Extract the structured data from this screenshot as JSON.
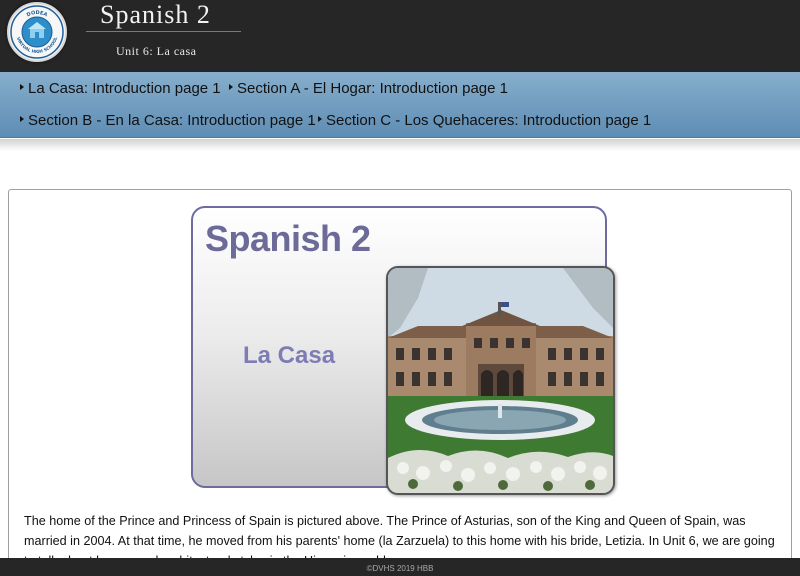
{
  "header": {
    "logo_icon": "school-seal-icon",
    "logo_text_top": "DODEA",
    "logo_text_bottom": "VIRTUAL HIGH SCHOOL",
    "title": "Spanish 2",
    "subtitle": "Unit 6: La casa"
  },
  "nav": {
    "items": [
      {
        "label": "La Casa: Introduction page 1",
        "current": true
      },
      {
        "label": "Section A - El Hogar: Introduction page 1"
      },
      {
        "label": "Section B - En la Casa: Introduction page 1"
      },
      {
        "label": "Section C - Los Quehaceres: Introduction page 1"
      }
    ]
  },
  "banner": {
    "title": "Spanish 2",
    "subtitle": "La Casa",
    "photo_icon": "palace-photo-image"
  },
  "content": {
    "paragraph": "The home of the Prince and Princess of Spain is pictured above. The Prince of Asturias, son of the King and Queen of Spain, was married in 2004. At that time, he moved from his parents' home (la Zarzuela) to this home with his bride, Letizia. In Unit 6, we are going to talk about homes and architectural styles in the Hispanic world."
  },
  "footer": {
    "text": "©DVHS 2019 HBB"
  },
  "colors": {
    "header_bg": "#262626",
    "nav_top": "#87aecc",
    "nav_bottom": "#5e8db4",
    "banner_title": "#6b6a98",
    "banner_subtitle": "#7d7cb4"
  }
}
